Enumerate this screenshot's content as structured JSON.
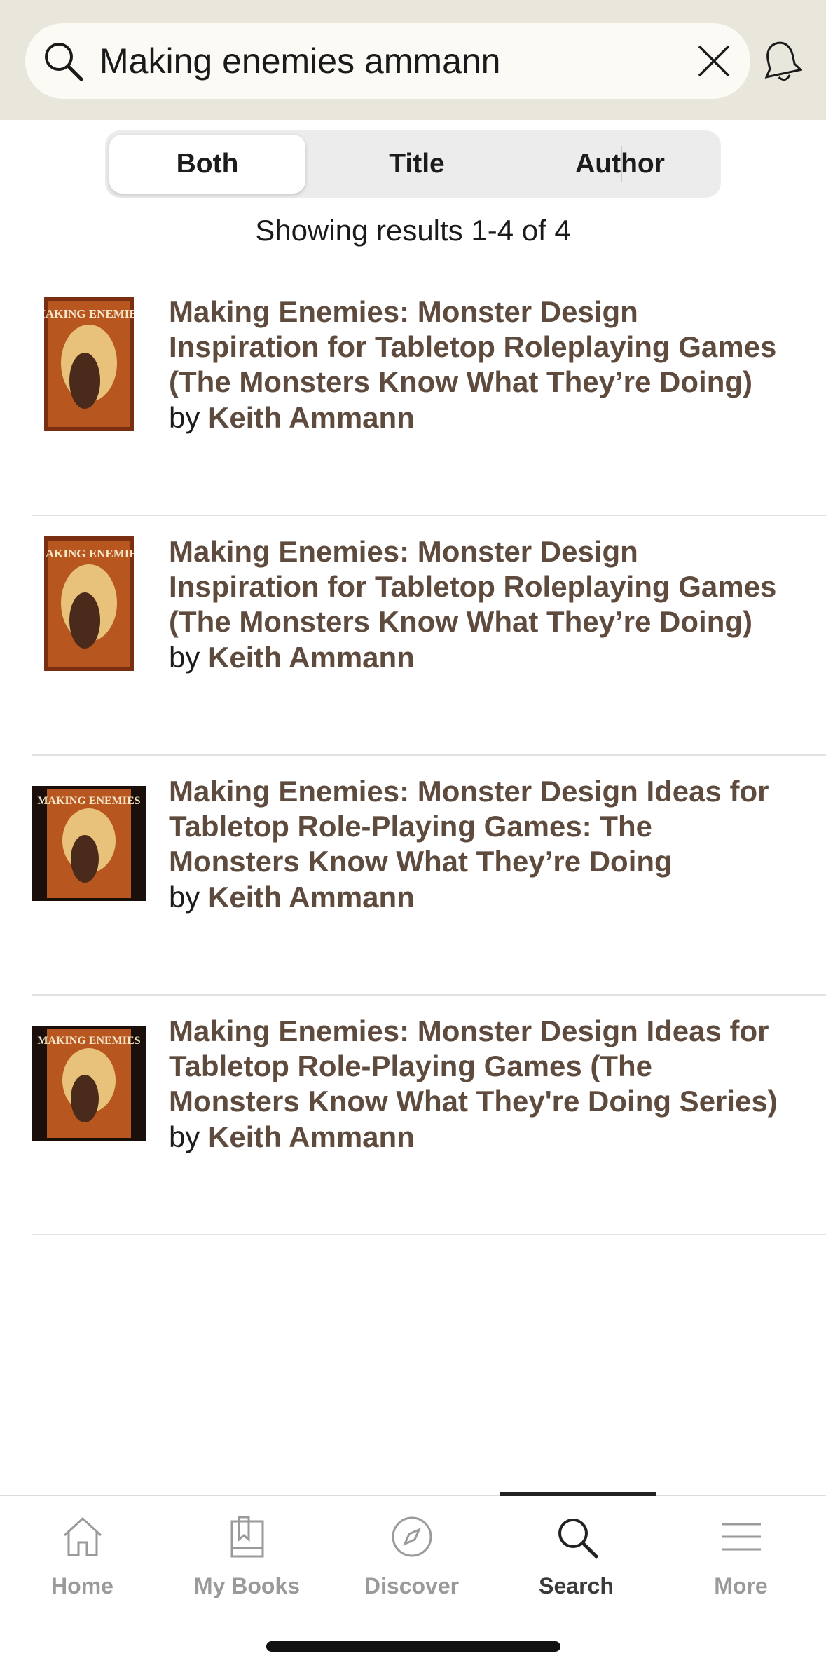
{
  "search": {
    "query": "Making enemies ammann"
  },
  "filter": {
    "options": [
      "Both",
      "Title",
      "Author"
    ],
    "selected": "Both"
  },
  "results_summary": "Showing results 1-4 of 4",
  "results": [
    {
      "title": "Making Enemies: Monster Design Inspiration for Tabletop Roleplaying Games (The Monsters Know What They’re Doing)",
      "by": "by",
      "author": "Keith Ammann",
      "cover_text": "MAKING ENEMIES"
    },
    {
      "title": "Making Enemies: Monster Design Inspiration for Tabletop Roleplaying Games (The Monsters Know What They’re Doing)",
      "by": "by",
      "author": "Keith Ammann",
      "cover_text": "MAKING ENEMIES"
    },
    {
      "title": "Making Enemies: Monster Design Ideas for Tabletop Role-Playing Games: The Monsters Know What They’re Doing",
      "by": "by",
      "author": "Keith Ammann",
      "cover_text": "MAKING ENEMIES"
    },
    {
      "title": "Making Enemies: Monster Design Ideas for Tabletop Role-Playing Games (The Monsters Know What They're Doing Series)",
      "by": "by",
      "author": "Keith Ammann",
      "cover_text": "MAKING ENEMIES"
    }
  ],
  "tabs": [
    {
      "label": "Home",
      "icon": "home-icon"
    },
    {
      "label": "My Books",
      "icon": "books-icon"
    },
    {
      "label": "Discover",
      "icon": "compass-icon"
    },
    {
      "label": "Search",
      "icon": "search-icon",
      "active": true
    },
    {
      "label": "More",
      "icon": "menu-icon"
    }
  ],
  "colors": {
    "header_bg": "#e9e6db",
    "link_brown": "#5e4b3e"
  }
}
